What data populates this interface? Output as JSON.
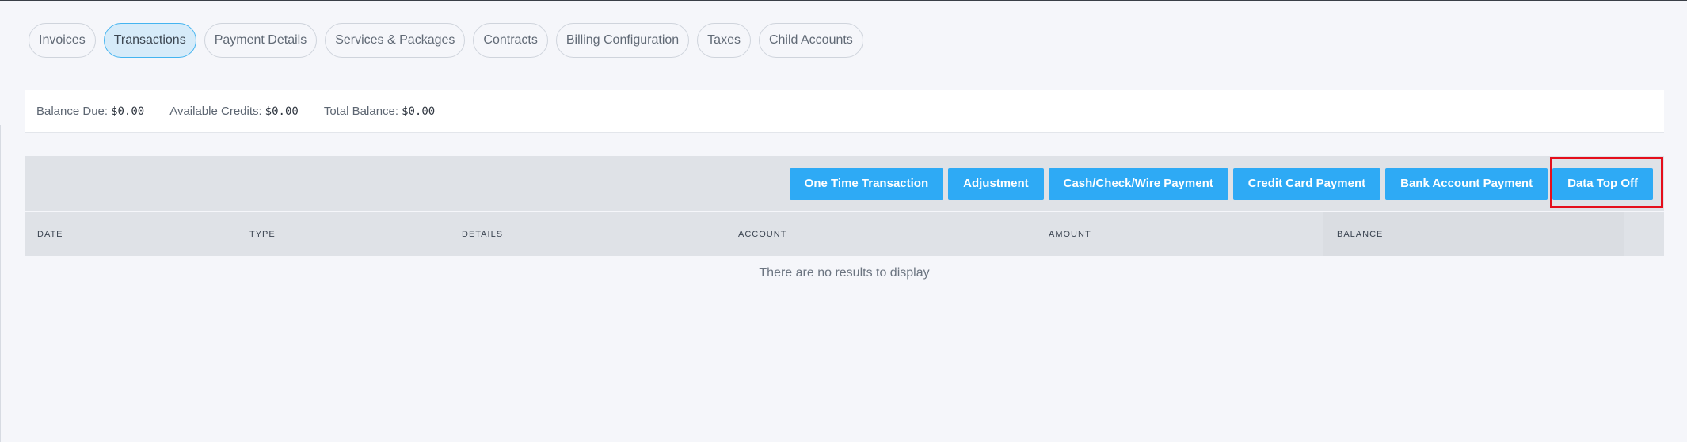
{
  "tabs": [
    {
      "label": "Invoices",
      "active": false
    },
    {
      "label": "Transactions",
      "active": true
    },
    {
      "label": "Payment Details",
      "active": false
    },
    {
      "label": "Services & Packages",
      "active": false
    },
    {
      "label": "Contracts",
      "active": false
    },
    {
      "label": "Billing Configuration",
      "active": false
    },
    {
      "label": "Taxes",
      "active": false
    },
    {
      "label": "Child Accounts",
      "active": false
    }
  ],
  "balances": {
    "balance_due_label": "Balance Due:",
    "balance_due_value": "$0.00",
    "available_credits_label": "Available Credits:",
    "available_credits_value": "$0.00",
    "total_balance_label": "Total Balance:",
    "total_balance_value": "$0.00"
  },
  "actions": {
    "one_time_transaction": "One Time Transaction",
    "adjustment": "Adjustment",
    "cash_check_wire": "Cash/Check/Wire Payment",
    "credit_card": "Credit Card Payment",
    "bank_account": "Bank Account Payment",
    "data_top_off": "Data Top Off"
  },
  "table": {
    "columns": [
      "DATE",
      "TYPE",
      "DETAILS",
      "ACCOUNT",
      "AMOUNT",
      "BALANCE"
    ],
    "empty_message": "There are no results to display"
  },
  "colors": {
    "accent": "#2eaaf5",
    "highlight": "#e50e1b",
    "active_tab_bg": "#d6ebf9"
  }
}
